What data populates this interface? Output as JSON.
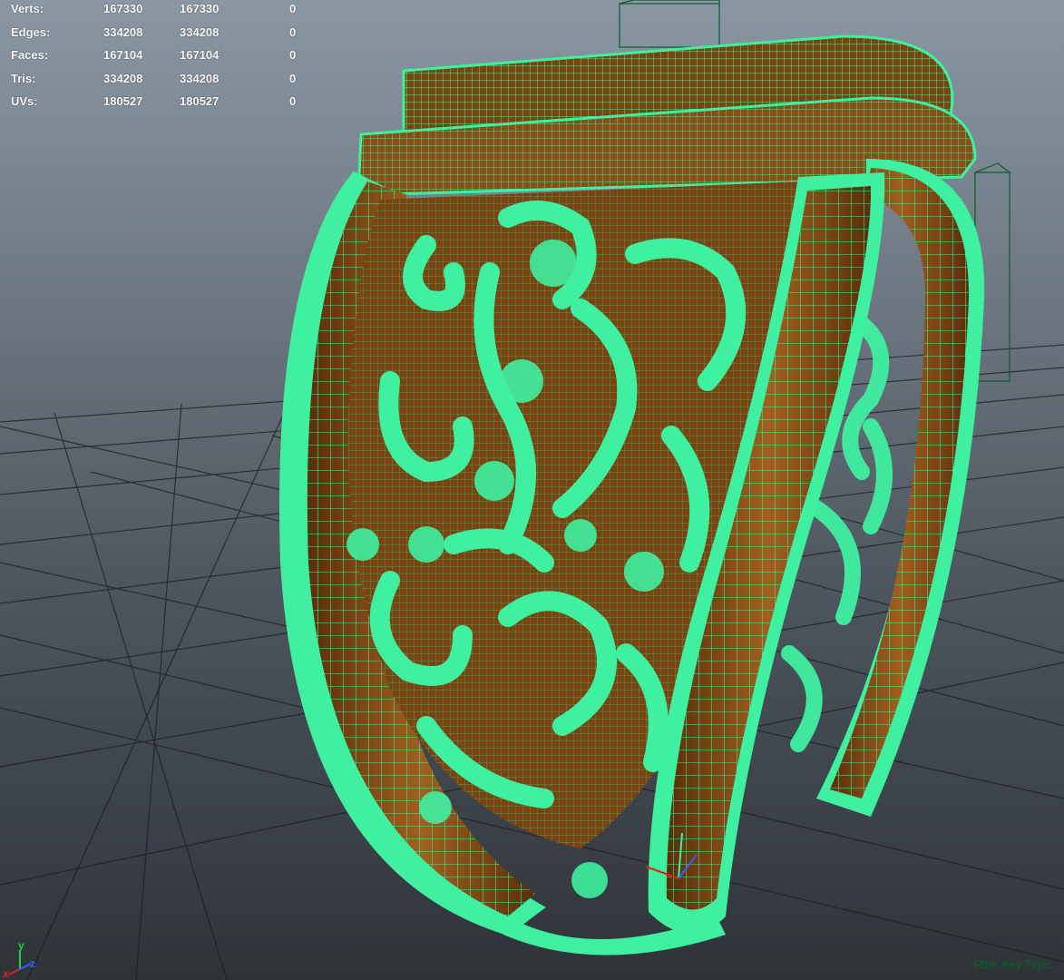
{
  "hud": {
    "rows": [
      {
        "label": "Verts:",
        "v1": "167330",
        "v2": "167330",
        "v3": "0"
      },
      {
        "label": "Edges:",
        "v1": "334208",
        "v2": "334208",
        "v3": "0"
      },
      {
        "label": "Faces:",
        "v1": "167104",
        "v2": "167104",
        "v3": "0"
      },
      {
        "label": "Tris:",
        "v1": "334208",
        "v2": "334208",
        "v3": "0"
      },
      {
        "label": "UVs:",
        "v1": "180527",
        "v2": "180527",
        "v3": "0"
      }
    ]
  },
  "axis": {
    "x": "x",
    "y": "y",
    "z": "z"
  },
  "status": {
    "fbik": "FBIK Key Type:"
  },
  "colors": {
    "wireframe": "#3ff0a0",
    "surface": "#7a4310",
    "grid": "#000000"
  }
}
